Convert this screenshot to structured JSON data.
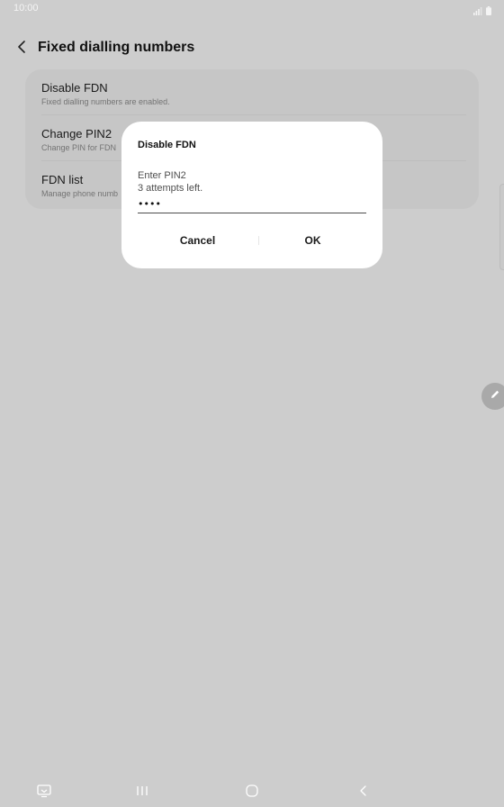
{
  "status_bar": {
    "time": "10:00"
  },
  "header": {
    "title": "Fixed dialling numbers"
  },
  "settings": {
    "items": [
      {
        "title": "Disable FDN",
        "subtitle": "Fixed dialling numbers are enabled."
      },
      {
        "title": "Change PIN2",
        "subtitle": "Change PIN for FDN"
      },
      {
        "title": "FDN list",
        "subtitle": "Manage phone numb"
      }
    ]
  },
  "dialog": {
    "title": "Disable FDN",
    "message_line1": "Enter PIN2",
    "message_line2": "3 attempts left.",
    "pin_value": "••••",
    "cancel_label": "Cancel",
    "ok_label": "OK"
  },
  "icons": {
    "back": "chevron-left-icon",
    "pen": "pen-icon",
    "signal": "signal-icon",
    "battery": "battery-icon",
    "keyboard_toggle": "keyboard-icon",
    "recents": "recent-apps-icon",
    "home": "home-icon",
    "nav_back": "back-icon"
  },
  "colors": {
    "background_dim": "#cdcdcd",
    "dialog_bg": "#ffffff",
    "text_primary": "#1a1a1a"
  }
}
